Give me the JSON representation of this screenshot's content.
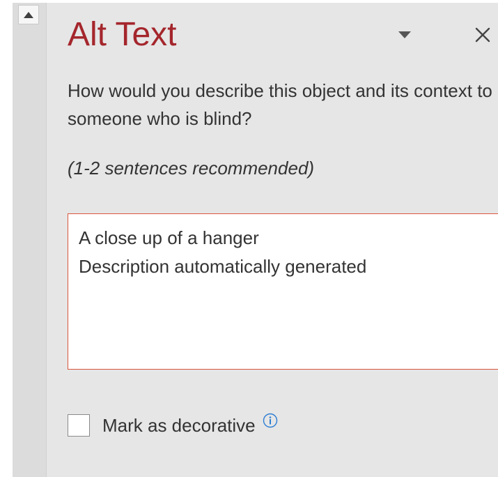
{
  "pane": {
    "title": "Alt Text",
    "question": "How would you describe this object and its context to someone who is blind?",
    "hint": "(1-2 sentences recommended)",
    "alt_text": {
      "line1": "A close up of a hanger",
      "line2": "Description automatically generated"
    },
    "decorative": {
      "label": "Mark as decorative",
      "checked": false
    }
  },
  "icons": {
    "scroll_up": "triangle-up-icon",
    "pane_menu": "chevron-down-icon",
    "close": "close-icon",
    "info": "info-icon"
  },
  "colors": {
    "title": "#a4262c",
    "input_border": "#d9553d",
    "pane_background": "#e6e6e6",
    "info_icon": "#2b7cd3"
  }
}
